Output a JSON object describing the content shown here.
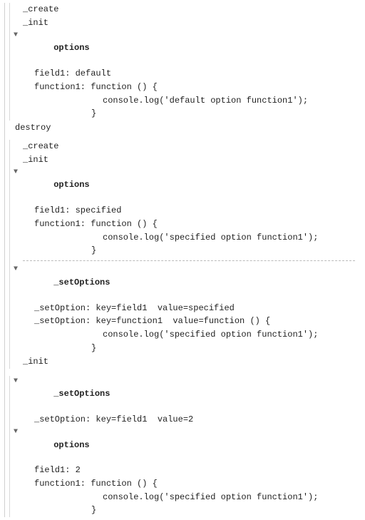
{
  "glyphs": {
    "disclosure_open": "▼"
  },
  "labels": {
    "create": "_create",
    "init": "_init",
    "options": "options",
    "setOptions": "_setOptions",
    "destroy": "destroy"
  },
  "block1": {
    "field1": "field1: default",
    "fn_head": "function1: function () {",
    "fn_body": "console.log('default option function1');",
    "fn_close": "}"
  },
  "block2": {
    "field1": "field1: specified",
    "fn_head": "function1: function () {",
    "fn_body": "console.log('specified option function1');",
    "fn_close": "}"
  },
  "block2b": {
    "line1": "_setOption: key=field1  value=specified",
    "line2": "_setOption: key=function1  value=function () {",
    "body": "console.log('specified option function1');",
    "close": "}"
  },
  "block3a": {
    "line1": "_setOption: key=field1  value=2"
  },
  "block3b": {
    "field1": "field1: 2",
    "fn_head": "function1: function () {",
    "fn_body": "console.log('specified option function1');",
    "fn_close": "}"
  }
}
